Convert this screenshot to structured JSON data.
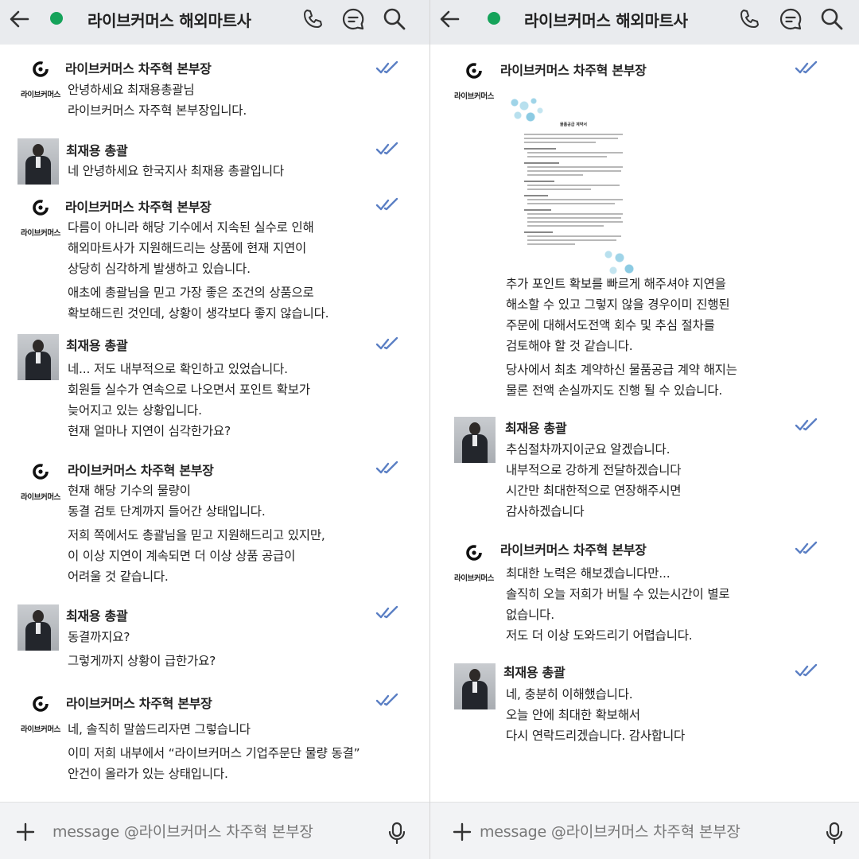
{
  "colors": {
    "header_bg": "#e9ebee",
    "status_dot": "#15a35a",
    "check_blue": "#5b7fc4"
  },
  "screens": [
    {
      "header": {
        "title": "라이브커머스 해외마트사",
        "back_icon": "back-arrow-icon",
        "phone_icon": "phone-icon",
        "chat_icon": "chat-icon",
        "search_icon": "search-icon"
      },
      "messages": [
        {
          "sender": "라이브커머스 차주혁 본부장",
          "avatar": "logo",
          "paragraphs": [
            [
              "안녕하세요 최재용총괄님",
              "라이브커머스 자주혁 본부장입니다."
            ]
          ]
        },
        {
          "sender": "최재용 총괄",
          "avatar": "photo",
          "paragraphs": [
            [
              "네 안녕하세요 한국지사 최재용 총괄입니다"
            ]
          ]
        },
        {
          "sender": "라이브커머스 차주혁 본부장",
          "avatar": "logo",
          "paragraphs": [
            [
              "다름이 아니라 해당 기수에서 지속된 실수로 인해",
              "해외마트사가 지원해드리는 상품에 현재 지연이",
              "상당히 심각하게 발생하고 있습니다."
            ],
            [
              "애초에 총괄님을 믿고 가장 좋은 조건의 상품으로",
              "확보해드린 것인데, 상황이 생각보다 좋지 않습니다."
            ]
          ]
        },
        {
          "sender": "최재용 총괄",
          "avatar": "photo",
          "paragraphs": [
            [
              "네... 저도 내부적으로 확인하고 있었습니다.",
              "회원들 실수가 연속으로 나오면서 포인트 확보가",
              "늦어지고 있는 상황입니다.",
              "현재 얼마나 지연이 심각한가요?"
            ]
          ]
        },
        {
          "sender": "라이브커머스 차주혁 본부장",
          "avatar": "logo",
          "paragraphs": [
            [
              "현재 해당 기수의 물량이",
              "동결 검토 단계까지 들어간 상태입니다."
            ],
            [
              "저희 쪽에서도 총괄님을 믿고 지원해드리고 있지만,",
              "이 이상 지연이 계속되면 더 이상 상품 공급이",
              "어려울 것 같습니다."
            ]
          ]
        },
        {
          "sender": "최재용 총괄",
          "avatar": "photo",
          "paragraphs": [
            [
              "동결까지요?"
            ],
            [
              "그렇게까지 상황이 급한가요?"
            ]
          ]
        },
        {
          "sender": "라이브커머스 차주혁 본부장",
          "avatar": "logo",
          "paragraphs": [
            [
              "네, 솔직히 말씀드리자면 그렇습니다"
            ],
            [
              "이미 저희 내부에서 “라이브커머스 기업주문단 물량 동결”",
              "안건이 올라가 있는 상태입니다."
            ]
          ]
        }
      ],
      "input": {
        "placeholder": "message @라이브커머스 차주혁 본부장",
        "plus_icon": "plus-icon",
        "mic_icon": "microphone-icon"
      }
    },
    {
      "header": {
        "title": "라이브커머스 해외마트사",
        "back_icon": "back-arrow-icon",
        "phone_icon": "phone-icon",
        "chat_icon": "chat-icon",
        "search_icon": "search-icon"
      },
      "messages": [
        {
          "sender": "라이브커머스 차주혁 본부장",
          "avatar": "logo",
          "attachment": {
            "type": "document-image",
            "title": "물품공급 계약서"
          },
          "paragraphs": [
            [
              "추가 포인트 확보를 빠르게 해주셔야 지연을",
              "해소할 수 있고 그렇지 않을 경우이미 진행된",
              "주문에 대해서도전액 회수 및 추심 절차를",
              "검토해야 할 것 같습니다."
            ],
            [
              "당사에서 최초 계약하신 물품공급 계약 해지는",
              "물론 전액 손실까지도 진행 될 수 있습니다."
            ]
          ]
        },
        {
          "sender": "최재용 총괄",
          "avatar": "photo",
          "paragraphs": [
            [
              "추심절차까지이군요 알겠습니다."
            ],
            [
              "내부적으로 강하게 전달하겠습니다"
            ],
            [
              "시간만 최대한적으로 연장해주시면",
              "감사하겠습니다"
            ]
          ]
        },
        {
          "sender": "라이브커머스 차주혁 본부장",
          "avatar": "logo",
          "paragraphs": [
            [
              "최대한 노력은 해보겠습니다만...",
              "솔직히 오늘 저희가 버틸 수 있는시간이 별로",
              "없습니다.",
              "저도 더 이상 도와드리기 어렵습니다."
            ]
          ]
        },
        {
          "sender": "최재용 총괄",
          "avatar": "photo",
          "paragraphs": [
            [
              "네, 충분히 이해했습니다.",
              "오늘 안에 최대한 확보해서",
              "다시 연락드리겠습니다. 감사합니다"
            ]
          ]
        }
      ],
      "input": {
        "placeholder": "message @라이브커머스 차주혁 본부장",
        "plus_icon": "plus-icon",
        "mic_icon": "microphone-icon"
      }
    }
  ],
  "logo_text": "라이브커머스"
}
